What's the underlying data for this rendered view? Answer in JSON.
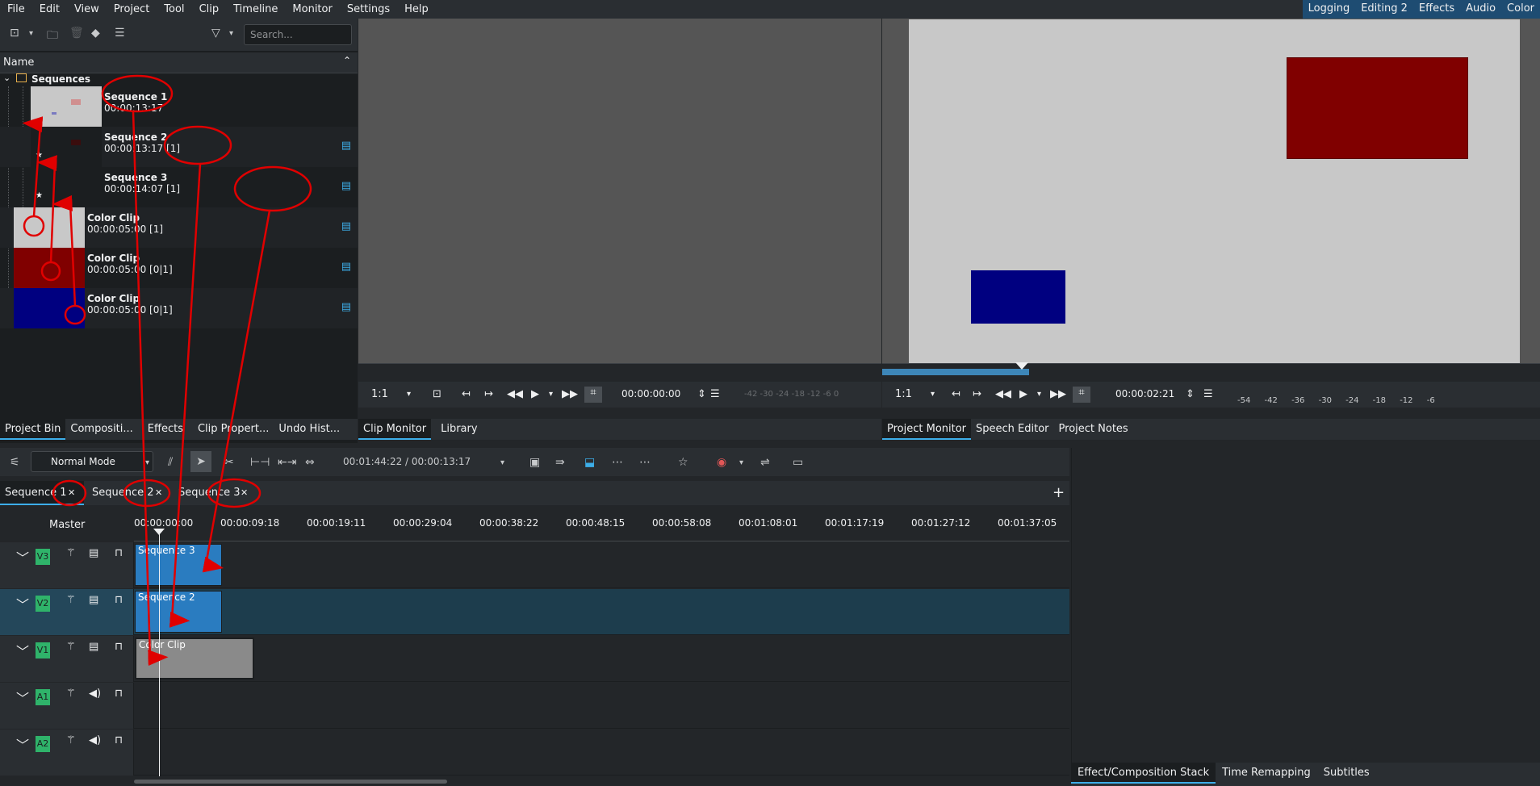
{
  "menubar": {
    "items": [
      "File",
      "Edit",
      "View",
      "Project",
      "Tool",
      "Clip",
      "Timeline",
      "Monitor",
      "Settings",
      "Help"
    ],
    "layouts": [
      "Logging",
      "Editing 2",
      "Effects",
      "Audio",
      "Color"
    ]
  },
  "bin": {
    "search_placeholder": "Search...",
    "column_header": "Name",
    "folder": "Sequences",
    "items": [
      {
        "name": "Sequence 1",
        "duration": "00:00:13:17"
      },
      {
        "name": "Sequence 2",
        "duration": "00:00:13:17 [1]"
      },
      {
        "name": "Sequence 3",
        "duration": "00:00:14:07 [1]"
      },
      {
        "name": "Color Clip",
        "duration": "00:00:05:00 [1]"
      },
      {
        "name": "Color Clip",
        "duration": "00:00:05:00 [0|1]"
      },
      {
        "name": "Color Clip",
        "duration": "00:00:05:00 [0|1]"
      }
    ],
    "tabs": [
      "Project Bin",
      "Compositi...",
      "Effects",
      "Clip Propert...",
      "Undo Hist..."
    ]
  },
  "clip_monitor": {
    "zoom": "1:1",
    "timecode": "00:00:00:00",
    "meter_labels": [
      "-42",
      "-30",
      "-24",
      "-18",
      "-12",
      "-6",
      "0"
    ],
    "tabs": [
      "Clip Monitor",
      "Library"
    ]
  },
  "project_monitor": {
    "zoom": "1:1",
    "timecode": "00:00:02:21",
    "meter_labels": [
      "-54",
      "-42",
      "-36",
      "-30",
      "-24",
      "-18",
      "-12",
      "-6"
    ],
    "tabs": [
      "Project Monitor",
      "Speech Editor",
      "Project Notes"
    ]
  },
  "timeline": {
    "mode": "Normal Mode",
    "position": "00:01:44:22 / 00:00:13:17",
    "sequence_tabs": [
      "Sequence 1",
      "Sequence 2",
      "Sequence 3"
    ],
    "master_label": "Master",
    "ruler_labels": [
      "00:00:00:00",
      "00:00:09:18",
      "00:00:19:11",
      "00:00:29:04",
      "00:00:38:22",
      "00:00:48:15",
      "00:00:58:08",
      "00:01:08:01",
      "00:01:17:19",
      "00:01:27:12",
      "00:01:37:05"
    ],
    "tracks": [
      "V3",
      "V2",
      "V1",
      "A1",
      "A2"
    ],
    "clips": {
      "v3": "Sequence 3",
      "v2": "Sequence 2",
      "v1": "Color Clip"
    }
  },
  "right_panel_tabs": [
    "Effect/Composition Stack",
    "Time Remapping",
    "Subtitles"
  ],
  "colors": {
    "accent": "#3daee9",
    "clip_blue": "#2a7cc0",
    "red_rect": "#800000",
    "blue_rect": "#000080",
    "annotation": "#e00000"
  }
}
